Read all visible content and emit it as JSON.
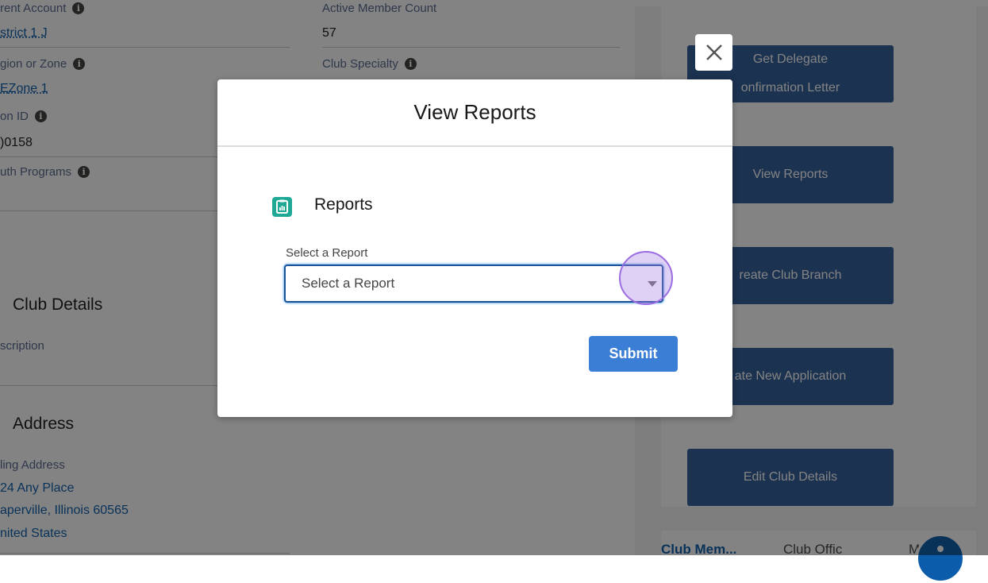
{
  "record": {
    "parent_account_label": "rent Account",
    "parent_account_value": "strict 1 J",
    "active_member_label": "Active Member Count",
    "active_member_value": "57",
    "region_label": "gion or Zone",
    "region_value": "Zone 1",
    "region_prefix": "E",
    "club_specialty_label": "Club Specialty",
    "on_id_label": "on ID",
    "on_id_value": ")0158",
    "youth_label": "uth Programs",
    "info_glyph": "i"
  },
  "sections": {
    "club_details_title": "Club Details",
    "description_label": "scription",
    "address_title": "Address",
    "mailing_label": "ling Address",
    "addr_line1": "24 Any Place",
    "addr_line2": "aperville, Illinois 60565",
    "addr_line3": "nited States"
  },
  "actions": {
    "delegate_line1": "Get Delegate",
    "delegate_line2": "onfirmation Letter",
    "view_reports": "View Reports",
    "create_branch": "reate Club Branch",
    "new_application": "ate New Application",
    "edit_details": "Edit Club Details"
  },
  "tabs": {
    "club_members": "Club Mem...",
    "club_officers": "Club Offic",
    "more": "M"
  },
  "modal": {
    "title": "View Reports",
    "close_glyph": "✕",
    "reports_heading": "Reports",
    "select_label": "Select a Report",
    "select_placeholder": "Select a Report",
    "submit_label": "Submit"
  },
  "colors": {
    "brand_button": "#2e5c99",
    "submit": "#3b7ed6",
    "reports_icon": "#1fa896",
    "link": "#0b5cab"
  }
}
